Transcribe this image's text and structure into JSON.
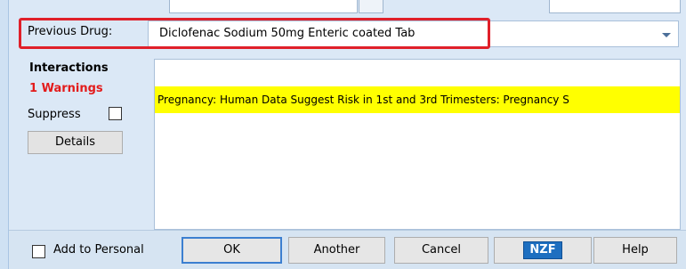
{
  "drug": {
    "label": "Previous Drug:",
    "value": "Diclofenac Sodium 50mg Enteric coated Tab"
  },
  "interactions": {
    "title": "Interactions",
    "warnings": "1 Warnings",
    "suppress_label": "Suppress",
    "details_label": "Details",
    "messages": [
      "Pregnancy: Human Data Suggest Risk in 1st and 3rd Trimesters: Pregnancy S"
    ]
  },
  "footer": {
    "add_to_personal_label": "Add to Personal",
    "ok_label": "OK",
    "another_label": "Another",
    "cancel_label": "Cancel",
    "nzf_label": "NZF",
    "help_label": "Help"
  },
  "colors": {
    "highlight_border": "#e0202a",
    "warning_text": "#e31b1b",
    "warning_background": "#ffff00",
    "panel_background": "#dbe8f6",
    "nzf_badge": "#1e6fc0"
  },
  "icons": {
    "combo_arrow": "chevron-down-icon"
  }
}
